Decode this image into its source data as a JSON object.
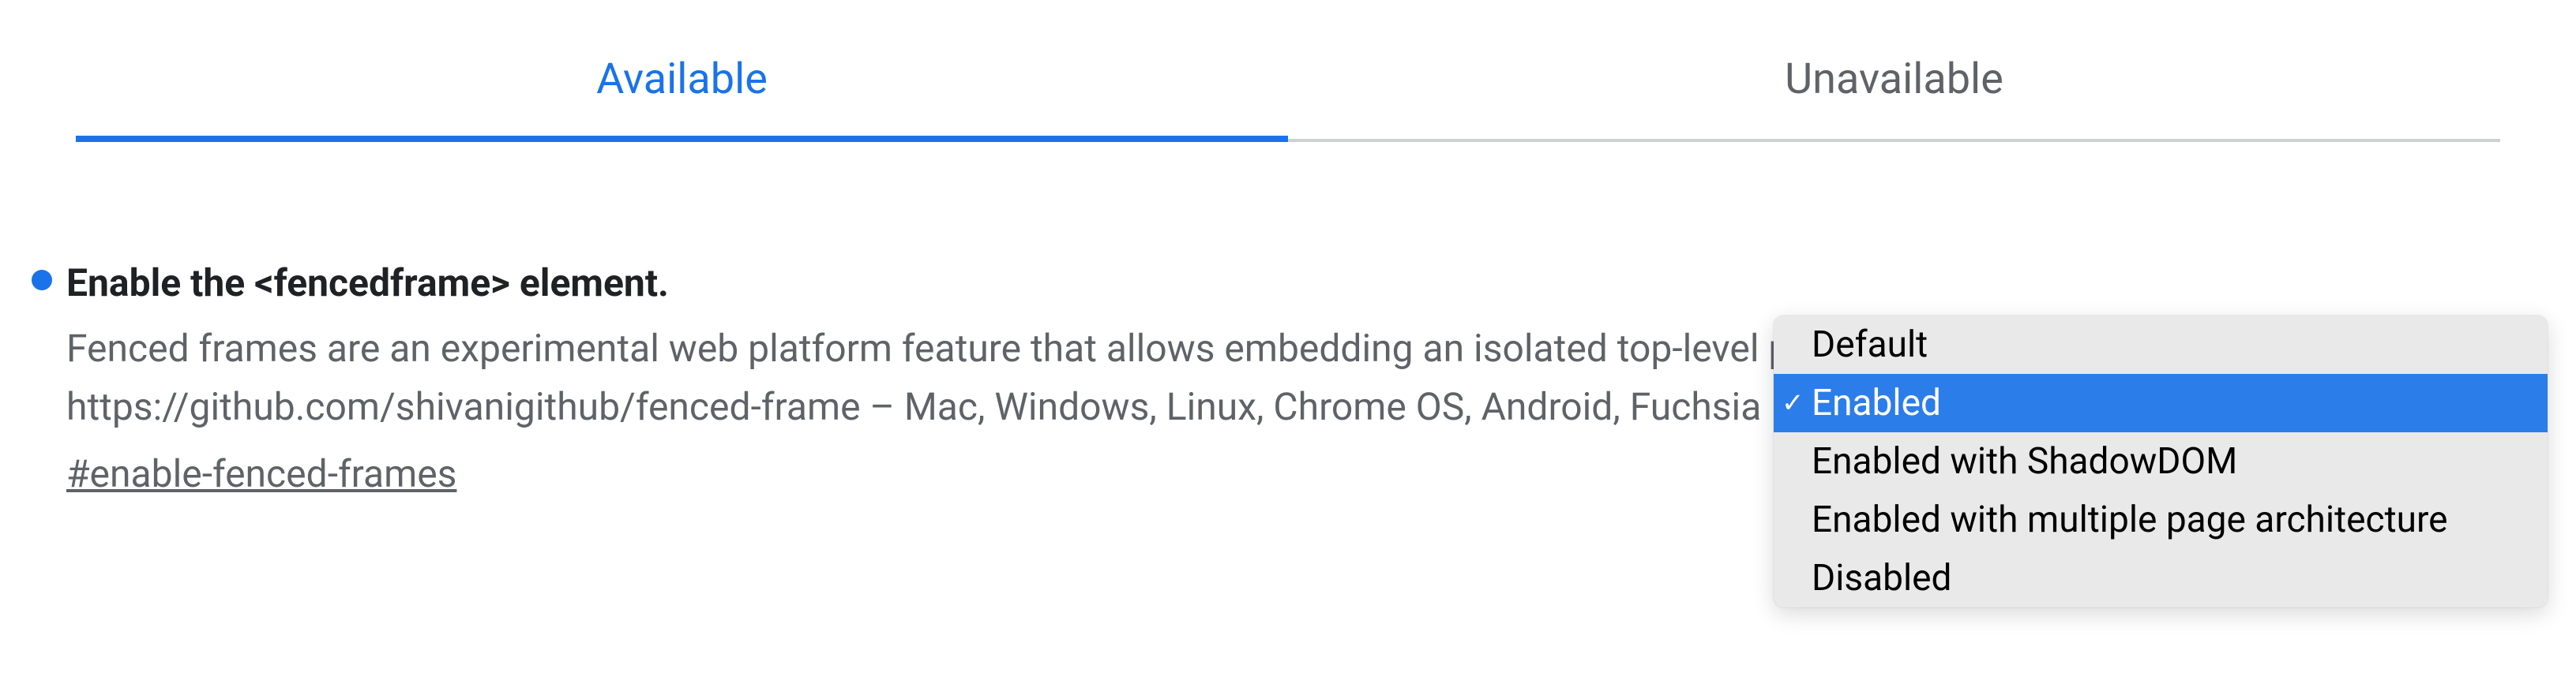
{
  "tabs": {
    "available": "Available",
    "unavailable": "Unavailable"
  },
  "flag": {
    "title": "Enable the <fencedframe> element.",
    "description": "Fenced frames are an experimental web platform feature that allows embedding an isolated top-level page. See https://github.com/shivanigithub/fenced-frame – Mac, Windows, Linux, Chrome OS, Android, Fuchsia",
    "hash": "#enable-fenced-frames"
  },
  "dropdown": {
    "options": [
      {
        "label": "Default",
        "selected": false
      },
      {
        "label": "Enabled",
        "selected": true
      },
      {
        "label": "Enabled with ShadowDOM",
        "selected": false
      },
      {
        "label": "Enabled with multiple page architecture",
        "selected": false
      },
      {
        "label": "Disabled",
        "selected": false
      }
    ]
  }
}
